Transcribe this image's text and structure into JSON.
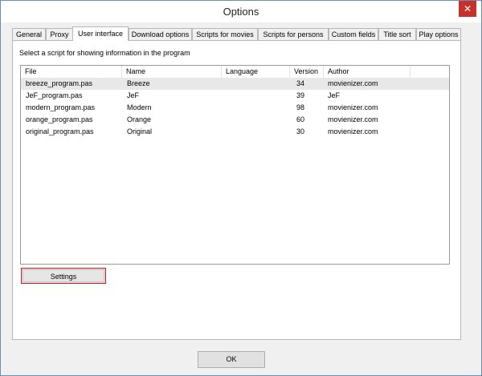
{
  "window": {
    "title": "Options",
    "close_glyph": "✕"
  },
  "tabs": [
    {
      "label": "General"
    },
    {
      "label": "Proxy"
    },
    {
      "label": "User interface",
      "active": true
    },
    {
      "label": "Download options"
    },
    {
      "label": "Scripts for movies"
    },
    {
      "label": "Scripts for persons"
    },
    {
      "label": "Custom fields"
    },
    {
      "label": "Title sort"
    },
    {
      "label": "Play options"
    }
  ],
  "panel": {
    "caption": "Select a script for showing information in the program"
  },
  "table": {
    "columns": [
      "File",
      "Name",
      "Language",
      "Version",
      "Author"
    ],
    "rows": [
      {
        "file": "breeze_program.pas",
        "name": "Breeze",
        "language": "",
        "version": "34",
        "author": "movienizer.com"
      },
      {
        "file": "JeF_program.pas",
        "name": "JeF",
        "language": "",
        "version": "39",
        "author": "JeF"
      },
      {
        "file": "modern_program.pas",
        "name": "Modern",
        "language": "",
        "version": "98",
        "author": "movienizer.com"
      },
      {
        "file": "orange_program.pas",
        "name": "Orange",
        "language": "",
        "version": "60",
        "author": "movienizer.com"
      },
      {
        "file": "original_program.pas",
        "name": "Original",
        "language": "",
        "version": "30",
        "author": "movienizer.com"
      }
    ]
  },
  "buttons": {
    "settings": "Settings",
    "ok": "OK"
  }
}
